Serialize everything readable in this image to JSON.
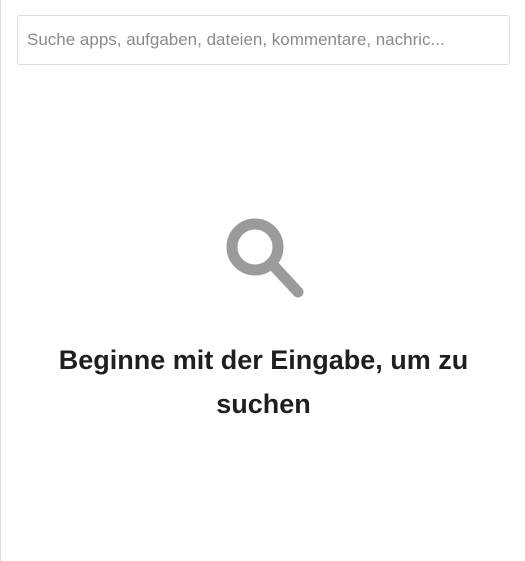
{
  "search": {
    "placeholder": "Suche apps, aufgaben, dateien, kommentare, nachric...",
    "value": ""
  },
  "empty_state": {
    "icon": "search-icon",
    "message": "Beginne mit der Eingabe, um zu suchen"
  },
  "colors": {
    "icon": "#9b9b9b",
    "text": "#1f1f1f",
    "border": "#dedede"
  }
}
